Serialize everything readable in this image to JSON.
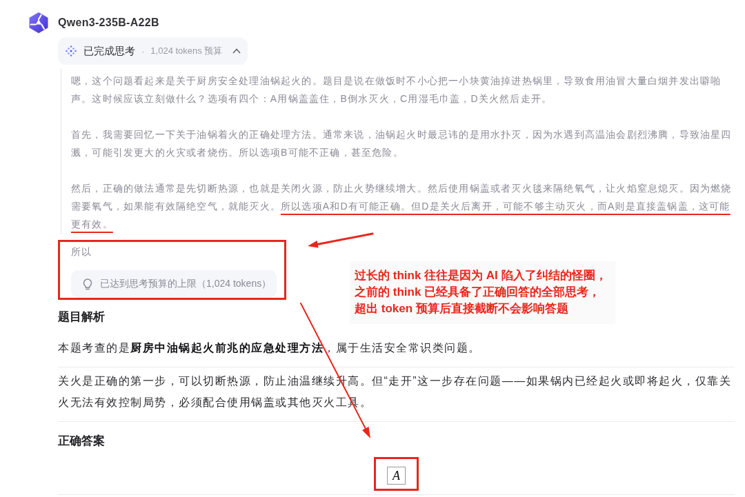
{
  "model": {
    "name": "Qwen3-235B-A22B"
  },
  "thinking": {
    "status": "已完成思考",
    "separator": "·",
    "budget": "1,024 tokens 预算",
    "expanded": true,
    "paragraphs": [
      {
        "segments": [
          {
            "text": "嗯，这个问题看起来是关于厨房安全处理油锅起火的。题目是说在做饭时不小心把一小块黄油掉进热锅里，导致食用油冒大量白烟并发出噼啪声。这时候应该立刻做什么？选项有四个：A用锅盖盖住，B倒水灭火，C用湿毛巾盖，D关火然后走开。",
            "underlined": false
          }
        ]
      },
      {
        "segments": [
          {
            "text": "首先，我需要回忆一下关于油锅着火的正确处理方法。通常来说，油锅起火时最忌讳的是用水扑灭，因为水遇到高温油会剧烈沸腾，导致油星四溅，可能引发更大的火灾或者烧伤。所以选项B可能不正确，甚至危险。",
            "underlined": false
          }
        ]
      },
      {
        "segments": [
          {
            "text": "然后，正确的做法通常是先切断热源，也就是关闭火源，防止火势继续增大。然后使用锅盖或者灭火毯来隔绝氧气，让火焰窒息熄灭。因为燃烧需要氧气，如果能有效隔绝空气，就能灭火。",
            "underlined": false
          },
          {
            "text": "所以选项A和D有可能正确。但D是关火后离开，可能不够主动灭火，而A则是直接盖锅盖，这可能更有效。",
            "underlined": true
          }
        ]
      }
    ],
    "cutoff": {
      "text": "所以",
      "notice": "已达到思考预算的上限（1,024 tokens）",
      "framed": true
    }
  },
  "answer": {
    "blocks": [
      {
        "kind": "heading",
        "text": "题目解析"
      },
      {
        "kind": "paragraph",
        "text": "本题考查的是**厨房中油锅起火前兆的应急处理方法**，属于生活安全常识类问题。"
      },
      {
        "kind": "paragraph",
        "text": "关火是正确的第一步，可以切断热源，防止油温继续升高。但“走开”这一步存在问题——如果锅内已经起火或即将起火，仅靠关火无法有效控制局势，必须配合使用锅盖或其他灭火工具。"
      },
      {
        "kind": "heading",
        "text": "正确答案"
      },
      {
        "kind": "boxed",
        "text": "A",
        "framed": true
      }
    ]
  },
  "annotation": {
    "note": [
      "过长的 think 往往是因为 AI 陷入了纠结的怪圈，",
      "之前的 think 已经具备了正确回答的全部思考，",
      "超出 token 预算后直接截断不会影响答题"
    ]
  }
}
